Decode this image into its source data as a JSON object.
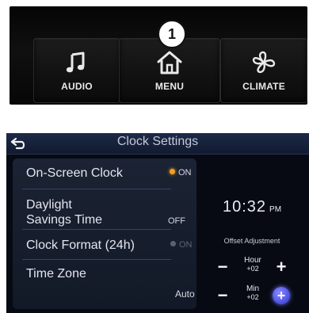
{
  "callout": {
    "number": "1"
  },
  "hardware_buttons": [
    {
      "label": "AUDIO",
      "icon": "music-note-icon"
    },
    {
      "label": "MENU",
      "icon": "home-icon"
    },
    {
      "label": "CLIMATE",
      "icon": "fan-icon"
    }
  ],
  "screen": {
    "title": "Clock Settings",
    "back_icon": "back-arrow-icon",
    "settings": [
      {
        "label": "On-Screen Clock",
        "value": "ON",
        "indicator_color": "#f0a020"
      },
      {
        "label_line1": "Daylight",
        "label_line2": "Savings Time",
        "value": "OFF"
      },
      {
        "label": "Clock Format (24h)",
        "value": "ON",
        "indicator_color": "#5c6272",
        "disabled": true
      },
      {
        "label": "Time Zone",
        "value": "Auto"
      }
    ],
    "clock": {
      "time": "10:32",
      "ampm": "PM"
    },
    "offset_label": "Offset Adjustment",
    "hour": {
      "label": "Hour",
      "value": "+02"
    },
    "min": {
      "label": "Min",
      "value": "+02"
    },
    "controls": {
      "minus": "−",
      "plus": "+"
    }
  },
  "colors": {
    "accent_on": "#f0a020",
    "selected_button": "#5256e6",
    "panel_bg": "#1b2334",
    "title_bar": "#1d2a47"
  }
}
